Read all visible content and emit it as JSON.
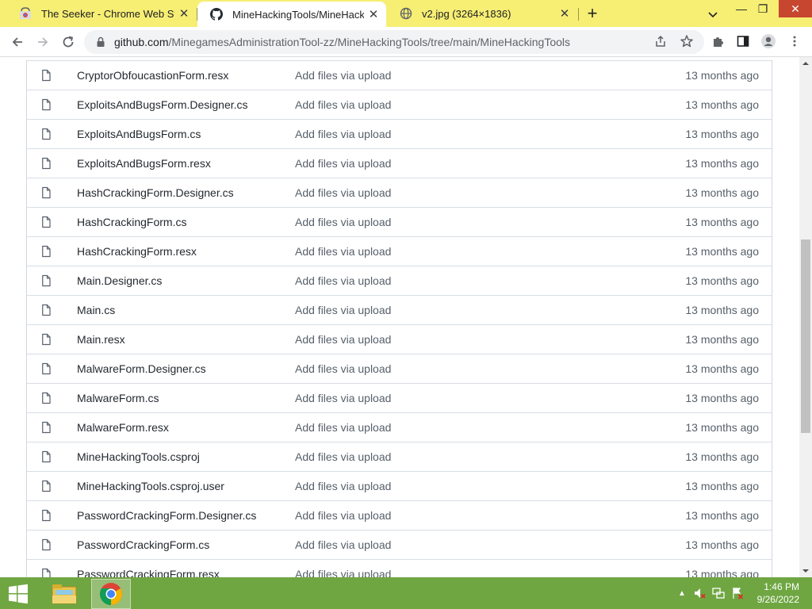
{
  "browser": {
    "tabs": [
      {
        "title": "The Seeker - Chrome Web Store",
        "icon": "chrome-web-store-icon",
        "active": false
      },
      {
        "title": "MineHackingTools/MineHacking",
        "icon": "github-icon",
        "active": true
      },
      {
        "title": "v2.jpg (3264×1836)",
        "icon": "globe-icon",
        "active": false
      }
    ],
    "new_tab_label": "+",
    "close_glyph": "✕",
    "address": {
      "host": "github.com",
      "path": "/MinegamesAdministrationTool-zz/MineHackingTools/tree/main/MineHackingTools"
    },
    "window_controls": {
      "minimize": "—",
      "maximize": "❐",
      "close": "✕"
    }
  },
  "files": [
    {
      "name": "CryptorObfoucastionForm.resx",
      "message": "Add files via upload",
      "age": "13 months ago"
    },
    {
      "name": "ExploitsAndBugsForm.Designer.cs",
      "message": "Add files via upload",
      "age": "13 months ago"
    },
    {
      "name": "ExploitsAndBugsForm.cs",
      "message": "Add files via upload",
      "age": "13 months ago"
    },
    {
      "name": "ExploitsAndBugsForm.resx",
      "message": "Add files via upload",
      "age": "13 months ago"
    },
    {
      "name": "HashCrackingForm.Designer.cs",
      "message": "Add files via upload",
      "age": "13 months ago"
    },
    {
      "name": "HashCrackingForm.cs",
      "message": "Add files via upload",
      "age": "13 months ago"
    },
    {
      "name": "HashCrackingForm.resx",
      "message": "Add files via upload",
      "age": "13 months ago"
    },
    {
      "name": "Main.Designer.cs",
      "message": "Add files via upload",
      "age": "13 months ago"
    },
    {
      "name": "Main.cs",
      "message": "Add files via upload",
      "age": "13 months ago"
    },
    {
      "name": "Main.resx",
      "message": "Add files via upload",
      "age": "13 months ago"
    },
    {
      "name": "MalwareForm.Designer.cs",
      "message": "Add files via upload",
      "age": "13 months ago"
    },
    {
      "name": "MalwareForm.cs",
      "message": "Add files via upload",
      "age": "13 months ago"
    },
    {
      "name": "MalwareForm.resx",
      "message": "Add files via upload",
      "age": "13 months ago"
    },
    {
      "name": "MineHackingTools.csproj",
      "message": "Add files via upload",
      "age": "13 months ago"
    },
    {
      "name": "MineHackingTools.csproj.user",
      "message": "Add files via upload",
      "age": "13 months ago"
    },
    {
      "name": "PasswordCrackingForm.Designer.cs",
      "message": "Add files via upload",
      "age": "13 months ago"
    },
    {
      "name": "PasswordCrackingForm.cs",
      "message": "Add files via upload",
      "age": "13 months ago"
    },
    {
      "name": "PasswordCrackingForm.resx",
      "message": "Add files via upload",
      "age": "13 months ago"
    }
  ],
  "taskbar": {
    "time": "1:46 PM",
    "date": "9/26/2022",
    "apps": [
      "file-explorer-icon",
      "chrome-icon"
    ]
  },
  "colors": {
    "tabstrip": "#f7ee74",
    "taskbar": "#6fa642"
  }
}
